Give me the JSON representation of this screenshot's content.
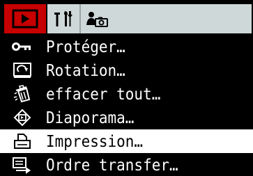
{
  "tabs": [
    {
      "id": "play",
      "icon": "playback-icon",
      "active": true
    },
    {
      "id": "setup",
      "icon": "tools-icon",
      "active": false
    },
    {
      "id": "mycamera",
      "icon": "person-camera-icon",
      "active": false
    }
  ],
  "menu": {
    "items": [
      {
        "label": "Protéger…",
        "icon": "key-icon",
        "selected": false
      },
      {
        "label": "Rotation…",
        "icon": "rotate-icon",
        "selected": false
      },
      {
        "label": "effacer tout…",
        "icon": "trash-icon",
        "selected": false
      },
      {
        "label": "Diaporama…",
        "icon": "slideshow-icon",
        "selected": false
      },
      {
        "label": "Impression…",
        "icon": "print-icon",
        "selected": true
      },
      {
        "label": "Ordre transfer…",
        "icon": "transfer-icon",
        "selected": false
      }
    ]
  },
  "colors": {
    "background": "#000000",
    "active_tab": "#c70000",
    "inactive_tab": "#cfd8d8",
    "text": "#ffffff",
    "selection": "#ffffff"
  }
}
